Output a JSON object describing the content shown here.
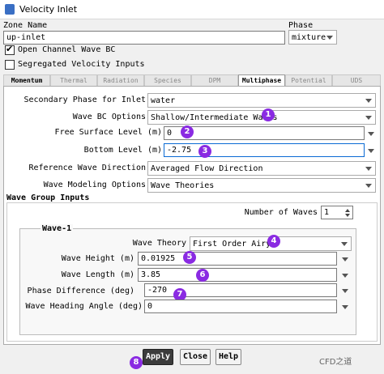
{
  "window": {
    "title": "Velocity Inlet"
  },
  "zone": {
    "label": "Zone Name",
    "value": "up-inlet"
  },
  "phase": {
    "label": "Phase",
    "value": "mixture"
  },
  "checkboxes": {
    "open_channel": {
      "label": "Open Channel Wave BC",
      "checked": true
    },
    "segregated": {
      "label": "Segregated Velocity Inputs",
      "checked": false
    }
  },
  "tabs": [
    "Momentum",
    "Thermal",
    "Radiation",
    "Species",
    "DPM",
    "Multiphase",
    "Potential",
    "UDS"
  ],
  "active_tab": "Multiphase",
  "form": {
    "secondary_phase": {
      "label": "Secondary Phase for Inlet",
      "value": "water"
    },
    "wave_bc": {
      "label": "Wave BC Options",
      "value": "Shallow/Intermediate Waves",
      "badge": "1"
    },
    "free_surface": {
      "label": "Free Surface Level (m)",
      "value": "0",
      "badge": "2"
    },
    "bottom_level": {
      "label": "Bottom Level (m)",
      "value": "-2.75",
      "badge": "3"
    },
    "ref_direction": {
      "label": "Reference Wave Direction",
      "value": "Averaged Flow Direction"
    },
    "modeling": {
      "label": "Wave Modeling Options",
      "value": "Wave Theories"
    }
  },
  "group": {
    "title": "Wave Group Inputs",
    "num_waves_label": "Number of Waves",
    "num_waves_value": "1",
    "wave_title": "Wave-1",
    "wave_theory": {
      "label": "Wave Theory",
      "value": "First Order Airy",
      "badge": "4"
    },
    "wave_height": {
      "label": "Wave Height (m)",
      "value": "0.01925",
      "badge": "5"
    },
    "wave_length": {
      "label": "Wave Length (m)",
      "value": "3.85",
      "badge": "6"
    },
    "phase_diff": {
      "label": "Phase Difference (deg)",
      "value": "-270",
      "badge": "7"
    },
    "heading": {
      "label": "Wave Heading Angle (deg)",
      "value": "0"
    }
  },
  "buttons": {
    "apply": "Apply",
    "close": "Close",
    "help": "Help",
    "badge": "8"
  },
  "watermark": "CFD之道",
  "colors": {
    "badge": "#8a2be2",
    "focus": "#0a6ad4"
  }
}
